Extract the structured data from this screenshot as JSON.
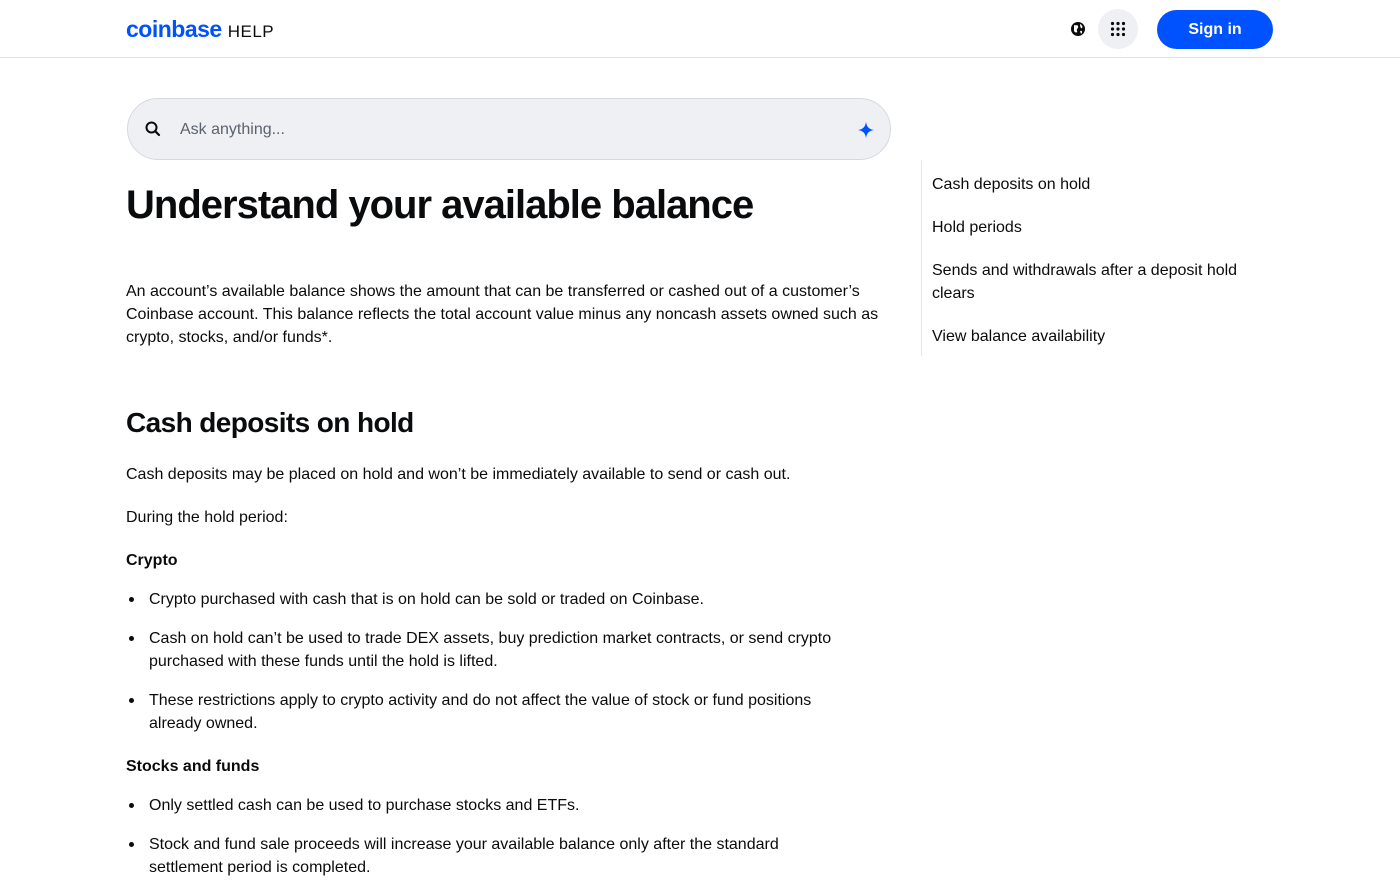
{
  "header": {
    "logo_text": "coinbase",
    "logo_suffix": "HELP",
    "signin_label": "Sign in",
    "globe_icon": "globe-icon",
    "apps_icon": "apps-grid-icon",
    "brand_color": "#0052ff"
  },
  "search": {
    "placeholder": "Ask anything...",
    "value": ""
  },
  "article": {
    "title": "Understand your available balance",
    "intro": "An account’s available balance shows the amount that can be transferred or cashed out of a customer’s Coinbase account. This balance reflects the total account value minus any noncash assets owned such as crypto, stocks, and/or funds*.",
    "section1": {
      "heading": "Cash deposits on hold",
      "para1": "Cash deposits may be placed on hold and won’t be immediately available to send or cash out.",
      "para2": "During the hold period:",
      "crypto_heading": "Crypto",
      "crypto_bullets": [
        "Crypto purchased with cash that is on hold can be sold or traded on Coinbase.",
        "Cash on hold can’t be used to trade DEX assets, buy prediction market contracts, or send crypto purchased with these funds until the hold is lifted.",
        "These restrictions apply to crypto activity and do not affect the value of stock or fund positions already owned."
      ],
      "stocks_heading": "Stocks and funds",
      "stocks_bullets": [
        "Only settled cash can be used to purchase stocks and ETFs.",
        "Stock and fund sale proceeds will increase your available balance only after the standard settlement period is completed."
      ]
    }
  },
  "toc": {
    "items": [
      "Cash deposits on hold",
      "Hold periods",
      "Sends and withdrawals after a deposit hold clears",
      "View balance availability"
    ]
  }
}
